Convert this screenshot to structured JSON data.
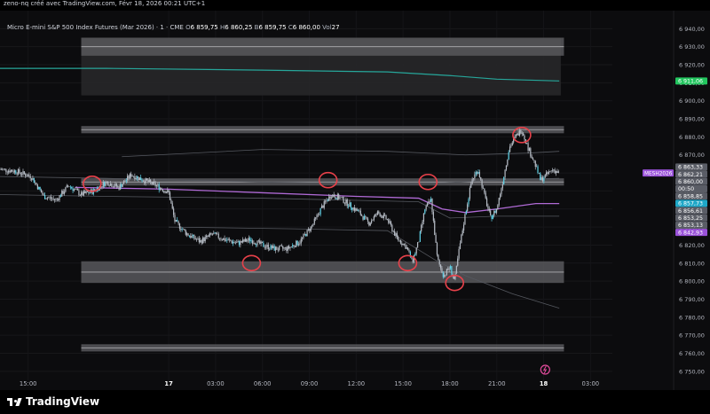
{
  "header": {
    "author_line": "zeno-nq créé avec TradingView.com, Févr 18, 2026 00:21 UTC+1",
    "symbol": "Micro E-mini S&P 500 Index Futures (Mar 2026) · 1 · CME",
    "ohlc": [
      {
        "label": "O",
        "value": "6 859,75"
      },
      {
        "label": "H",
        "value": "6 860,25"
      },
      {
        "label": "B",
        "value": "6 859,75"
      },
      {
        "label": "C",
        "value": "6 860,00"
      },
      {
        "label": "Vol",
        "value": "27"
      }
    ]
  },
  "footer": {
    "brand": "TradingView"
  },
  "colors": {
    "background": "#0c0c0e",
    "candles": "#b7bdc6",
    "candle_accent": "#5fd3e8",
    "purple_line": "#b06ad6",
    "green_line": "#26a69a",
    "zone_fill": "#4a4a4e",
    "circle": "#e8414a",
    "label_green": "#22c55e",
    "label_purple": "#9a52d9",
    "label_cyan": "#1ea7c7",
    "label_gray": "#5a5d66"
  },
  "chart_data": {
    "type": "candlestick",
    "y_ticks": [
      "6 940,00",
      "6 930,00",
      "6 920,00",
      "6 910,00",
      "6 900,00",
      "6 890,00",
      "6 880,00",
      "6 870,00",
      "6 860,00",
      "6 850,00",
      "6 840,00",
      "6 830,00",
      "6 820,00",
      "6 810,00",
      "6 800,00",
      "6 790,00",
      "6 780,00",
      "6 770,00",
      "6 760,00",
      "6 750,00"
    ],
    "ylim": [
      6745,
      6950
    ],
    "x_ticks": [
      {
        "label": "15:00",
        "h": 15,
        "bold": false
      },
      {
        "label": "17",
        "h": 24,
        "bold": true
      },
      {
        "label": "03:00",
        "h": 27,
        "bold": false
      },
      {
        "label": "06:00",
        "h": 30,
        "bold": false
      },
      {
        "label": "09:00",
        "h": 33,
        "bold": false
      },
      {
        "label": "12:00",
        "h": 36,
        "bold": false
      },
      {
        "label": "15:00",
        "h": 39,
        "bold": false
      },
      {
        "label": "18:00",
        "h": 42,
        "bold": false
      },
      {
        "label": "21:00",
        "h": 45,
        "bold": false
      },
      {
        "label": "18",
        "h": 48,
        "bold": true
      },
      {
        "label": "03:00",
        "h": 51,
        "bold": false
      }
    ],
    "xlim": [
      13.2,
      52.4
    ],
    "price_path": [
      [
        13.2,
        6862
      ],
      [
        14.2,
        6861
      ],
      [
        15.2,
        6858
      ],
      [
        16.0,
        6847
      ],
      [
        16.8,
        6845
      ],
      [
        17.6,
        6853
      ],
      [
        18.4,
        6848
      ],
      [
        19.2,
        6850
      ],
      [
        20.0,
        6855
      ],
      [
        20.8,
        6852
      ],
      [
        21.6,
        6859
      ],
      [
        22.4,
        6856
      ],
      [
        23.2,
        6853
      ],
      [
        24.0,
        6849
      ],
      [
        24.4,
        6833
      ],
      [
        25.2,
        6826
      ],
      [
        26.0,
        6822
      ],
      [
        26.8,
        6826
      ],
      [
        27.6,
        6823
      ],
      [
        28.4,
        6821
      ],
      [
        29.2,
        6823
      ],
      [
        30.0,
        6820
      ],
      [
        30.8,
        6818
      ],
      [
        31.6,
        6818
      ],
      [
        32.4,
        6822
      ],
      [
        33.2,
        6831
      ],
      [
        33.8,
        6841
      ],
      [
        34.4,
        6848
      ],
      [
        35.0,
        6846
      ],
      [
        35.6,
        6842
      ],
      [
        36.2,
        6838
      ],
      [
        36.8,
        6832
      ],
      [
        37.4,
        6838
      ],
      [
        38.0,
        6834
      ],
      [
        38.6,
        6824
      ],
      [
        39.2,
        6819
      ],
      [
        39.6,
        6811
      ],
      [
        40.0,
        6822
      ],
      [
        40.4,
        6840
      ],
      [
        40.8,
        6845
      ],
      [
        41.2,
        6812
      ],
      [
        41.6,
        6803
      ],
      [
        42.0,
        6808
      ],
      [
        42.3,
        6800
      ],
      [
        42.6,
        6818
      ],
      [
        43.0,
        6838
      ],
      [
        43.4,
        6856
      ],
      [
        43.8,
        6862
      ],
      [
        44.2,
        6848
      ],
      [
        44.6,
        6835
      ],
      [
        45.0,
        6840
      ],
      [
        45.4,
        6856
      ],
      [
        45.8,
        6874
      ],
      [
        46.2,
        6880
      ],
      [
        46.6,
        6884
      ],
      [
        47.0,
        6874
      ],
      [
        47.4,
        6866
      ],
      [
        47.8,
        6856
      ],
      [
        48.2,
        6859
      ],
      [
        48.6,
        6862
      ],
      [
        48.95,
        6860
      ]
    ],
    "purple_line": [
      [
        18.0,
        6852
      ],
      [
        24.0,
        6851
      ],
      [
        30.0,
        6849
      ],
      [
        36.0,
        6847
      ],
      [
        40.0,
        6846
      ],
      [
        41.5,
        6840
      ],
      [
        43.0,
        6838
      ],
      [
        45.0,
        6840
      ],
      [
        47.5,
        6843
      ],
      [
        49.0,
        6843
      ]
    ],
    "green_line": [
      [
        13.2,
        6918
      ],
      [
        20.0,
        6918
      ],
      [
        30.0,
        6917
      ],
      [
        38.0,
        6916
      ],
      [
        42.0,
        6914
      ],
      [
        45.0,
        6912
      ],
      [
        49.0,
        6911
      ]
    ],
    "band_lines": [
      [
        [
          13.2,
          6858
        ],
        [
          20,
          6857
        ],
        [
          30,
          6855
        ],
        [
          40,
          6854
        ],
        [
          45,
          6856
        ],
        [
          49,
          6857
        ]
      ],
      [
        [
          13.2,
          6848
        ],
        [
          20,
          6847
        ],
        [
          30,
          6846
        ],
        [
          40,
          6844
        ],
        [
          42,
          6835
        ],
        [
          45,
          6836
        ],
        [
          49,
          6836
        ]
      ],
      [
        [
          21,
          6869
        ],
        [
          30,
          6873
        ],
        [
          38,
          6872
        ],
        [
          43,
          6870
        ],
        [
          47,
          6871
        ],
        [
          49,
          6872
        ]
      ],
      [
        [
          24,
          6830
        ],
        [
          32,
          6829
        ],
        [
          38,
          6828
        ],
        [
          41,
          6812
        ],
        [
          43,
          6803
        ],
        [
          46,
          6793
        ],
        [
          49,
          6785
        ]
      ]
    ],
    "zones": [
      {
        "from": 6903,
        "to": 6935,
        "x0": 18.4,
        "x1": 49.1,
        "shade": "dark"
      },
      {
        "from": 6925,
        "to": 6935,
        "x0": 18.4,
        "x1": 49.3,
        "shade": "bright"
      },
      {
        "from": 6882,
        "to": 6886,
        "x0": 18.4,
        "x1": 49.3,
        "shade": "bright"
      },
      {
        "from": 6853,
        "to": 6857,
        "x0": 18.4,
        "x1": 49.3,
        "shade": "bright"
      },
      {
        "from": 6799,
        "to": 6811,
        "x0": 18.4,
        "x1": 49.3,
        "shade": "bright"
      },
      {
        "from": 6761,
        "to": 6765,
        "x0": 18.4,
        "x1": 49.3,
        "shade": "bright"
      }
    ],
    "circles": [
      [
        19.1,
        6854
      ],
      [
        29.3,
        6810
      ],
      [
        34.2,
        6856
      ],
      [
        39.3,
        6810
      ],
      [
        40.6,
        6855
      ],
      [
        42.3,
        6799
      ],
      [
        46.6,
        6881
      ]
    ],
    "price_labels": [
      {
        "text": "6 911,06",
        "value": 6911,
        "color": "green"
      },
      {
        "text": "6 863,33",
        "value": 6863.3,
        "color": "gray"
      },
      {
        "text": "6 862,21",
        "value": 6862.2,
        "color": "gray"
      },
      {
        "text": "6 860,00",
        "value": 6860,
        "color": "gray"
      },
      {
        "text": "00:50",
        "value": 6860,
        "color": "gray"
      },
      {
        "text": "6 858,85",
        "value": 6858.85,
        "color": "gray"
      },
      {
        "text": "6 857,73",
        "value": 6857.73,
        "color": "cyan"
      },
      {
        "text": "6 856,61",
        "value": 6856.61,
        "color": "gray"
      },
      {
        "text": "6 853,25",
        "value": 6853.25,
        "color": "gray"
      },
      {
        "text": "6 853,13",
        "value": 6853.13,
        "color": "gray"
      },
      {
        "text": "6 842,93",
        "value": 6842.93,
        "color": "purple"
      }
    ],
    "symbol_tag": {
      "text": "MESH2026",
      "value": 6860
    }
  }
}
